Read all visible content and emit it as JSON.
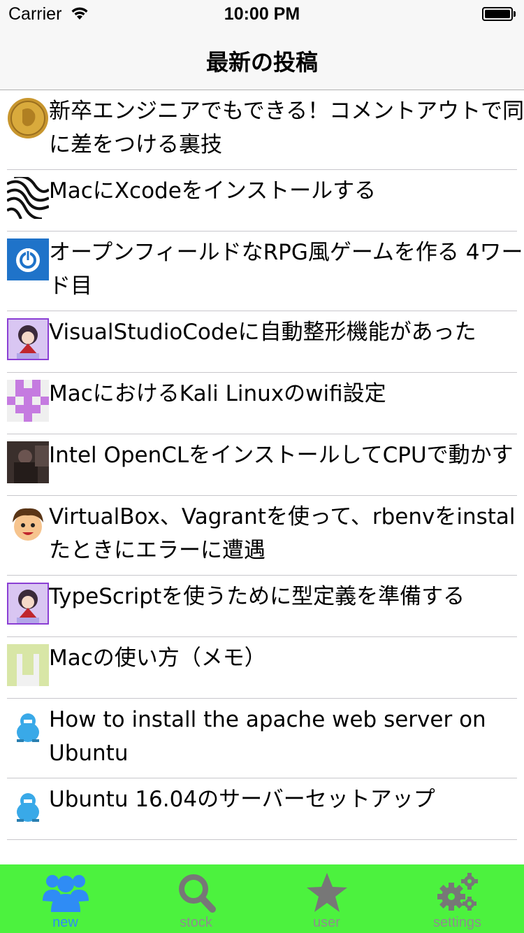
{
  "status_bar": {
    "carrier": "Carrier",
    "time": "10:00 PM"
  },
  "nav": {
    "title": "最新の投稿"
  },
  "posts": [
    {
      "lines": [
        "新卒エンジニアでもできる！コメントアウトで同",
        "に差をつける裏技"
      ],
      "avatar": "gold-coin-avatar"
    },
    {
      "lines": [
        "MacにXcodeをインストールする"
      ],
      "avatar": "zebra-avatar"
    },
    {
      "lines": [
        "オープンフィールドなRPG風ゲームを作る 4ワー",
        "ド目"
      ],
      "avatar": "power-button-avatar"
    },
    {
      "lines": [
        "VisualStudioCodeに自動整形機能があった"
      ],
      "avatar": "anime-girl-avatar"
    },
    {
      "lines": [
        "MacにおけるKali Linuxのwifi設定"
      ],
      "avatar": "purple-pixel-avatar"
    },
    {
      "lines": [
        "Intel OpenCLをインストールしてCPUで動かす"
      ],
      "avatar": "photo-avatar"
    },
    {
      "lines": [
        "VirtualBox、Vagrantを使って、rbenvをinstal",
        "たときにエラーに遭遇"
      ],
      "avatar": "cartoon-boy-avatar"
    },
    {
      "lines": [
        "TypeScriptを使うために型定義を準備する"
      ],
      "avatar": "anime-girl-avatar"
    },
    {
      "lines": [
        "Macの使い方（メモ）"
      ],
      "avatar": "green-pixel-avatar"
    },
    {
      "lines": [
        "How to install the apache web server on",
        "Ubuntu"
      ],
      "avatar": "blue-robot-avatar"
    },
    {
      "lines": [
        "Ubuntu 16.04のサーバーセットアップ"
      ],
      "avatar": "blue-robot-avatar"
    }
  ],
  "tabs": [
    {
      "label": "new",
      "icon": "people-icon",
      "active": true
    },
    {
      "label": "stock",
      "icon": "search-icon",
      "active": false
    },
    {
      "label": "user",
      "icon": "star-icon",
      "active": false
    },
    {
      "label": "settings",
      "icon": "gears-icon",
      "active": false
    }
  ],
  "colors": {
    "tab_bar_bg": "#4cf23e",
    "tab_active": "#2f8cf5",
    "tab_inactive": "#8e8e8e"
  }
}
